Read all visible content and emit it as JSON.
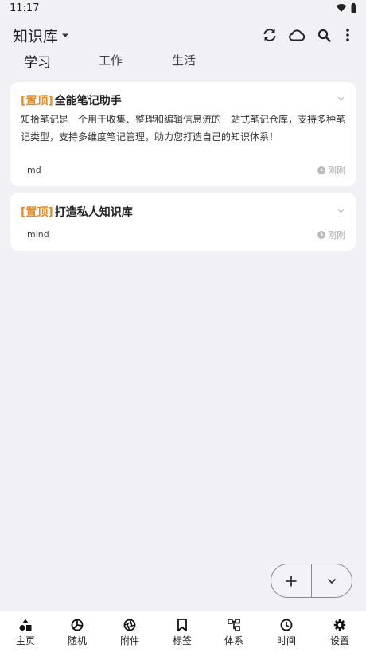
{
  "status": {
    "time": "11:17"
  },
  "header": {
    "title": "知识库"
  },
  "tabs": [
    {
      "label": "学习"
    },
    {
      "label": "工作"
    },
    {
      "label": "生活"
    }
  ],
  "notes": [
    {
      "pin": "[置顶]",
      "title": "全能笔记助手",
      "description": "知拾笔记是一个用于收集、整理和编辑信息流的一站式笔记仓库，支持多种笔记类型，支持多维度笔记管理，助力您打造自己的知识体系！",
      "type": "md",
      "time": "刚刚"
    },
    {
      "pin": "[置顶]",
      "title": "打造私人知识库",
      "type": "mind",
      "time": "刚刚"
    }
  ],
  "nav": [
    {
      "label": "主页",
      "icon": "home-shapes-icon"
    },
    {
      "label": "随机",
      "icon": "random-icon"
    },
    {
      "label": "附件",
      "icon": "aperture-icon"
    },
    {
      "label": "标签",
      "icon": "bookmark-icon"
    },
    {
      "label": "体系",
      "icon": "hierarchy-icon"
    },
    {
      "label": "时间",
      "icon": "clock-icon"
    },
    {
      "label": "设置",
      "icon": "gear-icon"
    }
  ],
  "colors": {
    "accent": "#f08a1a",
    "background": "#f1f0f5",
    "card": "#ffffff"
  }
}
